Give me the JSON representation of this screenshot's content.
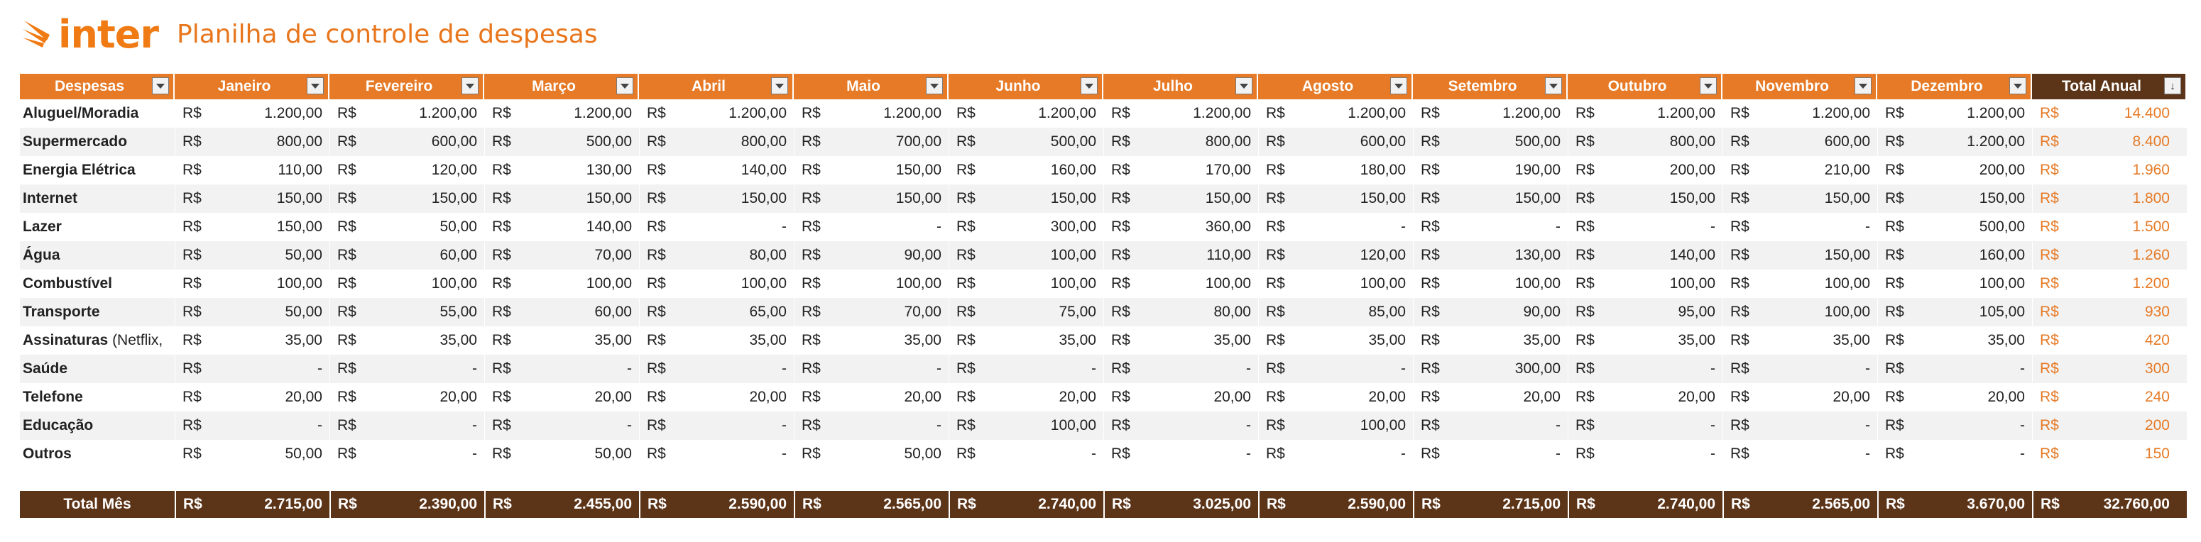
{
  "brand": {
    "logo_text": "inter",
    "accent": "#e67a26",
    "dark": "#5c3418"
  },
  "title": "Planilha de controle de despesas",
  "currency": "R$",
  "columns": {
    "expense": "Despesas",
    "months": [
      "Janeiro",
      "Fevereiro",
      "Março",
      "Abril",
      "Maio",
      "Junho",
      "Julho",
      "Agosto",
      "Setembro",
      "Outubro",
      "Novembro",
      "Dezembro"
    ],
    "total": "Total Anual"
  },
  "rows": [
    {
      "name": "Aluguel/Moradia",
      "values": [
        "1.200,00",
        "1.200,00",
        "1.200,00",
        "1.200,00",
        "1.200,00",
        "1.200,00",
        "1.200,00",
        "1.200,00",
        "1.200,00",
        "1.200,00",
        "1.200,00",
        "1.200,00"
      ],
      "total": "14.400"
    },
    {
      "name": "Supermercado",
      "values": [
        "800,00",
        "600,00",
        "500,00",
        "800,00",
        "700,00",
        "500,00",
        "800,00",
        "600,00",
        "500,00",
        "800,00",
        "600,00",
        "1.200,00"
      ],
      "total": "8.400"
    },
    {
      "name": "Energia Elétrica",
      "values": [
        "110,00",
        "120,00",
        "130,00",
        "140,00",
        "150,00",
        "160,00",
        "170,00",
        "180,00",
        "190,00",
        "200,00",
        "210,00",
        "200,00"
      ],
      "total": "1.960"
    },
    {
      "name": "Internet",
      "values": [
        "150,00",
        "150,00",
        "150,00",
        "150,00",
        "150,00",
        "150,00",
        "150,00",
        "150,00",
        "150,00",
        "150,00",
        "150,00",
        "150,00"
      ],
      "total": "1.800"
    },
    {
      "name": "Lazer",
      "values": [
        "150,00",
        "50,00",
        "140,00",
        "-",
        "-",
        "300,00",
        "360,00",
        "-",
        "-",
        "-",
        "-",
        "500,00"
      ],
      "total": "1.500"
    },
    {
      "name": "Água",
      "values": [
        "50,00",
        "60,00",
        "70,00",
        "80,00",
        "90,00",
        "100,00",
        "110,00",
        "120,00",
        "130,00",
        "140,00",
        "150,00",
        "160,00"
      ],
      "total": "1.260"
    },
    {
      "name": "Combustível",
      "values": [
        "100,00",
        "100,00",
        "100,00",
        "100,00",
        "100,00",
        "100,00",
        "100,00",
        "100,00",
        "100,00",
        "100,00",
        "100,00",
        "100,00"
      ],
      "total": "1.200"
    },
    {
      "name": "Transporte",
      "values": [
        "50,00",
        "55,00",
        "60,00",
        "65,00",
        "70,00",
        "75,00",
        "80,00",
        "85,00",
        "90,00",
        "95,00",
        "100,00",
        "105,00"
      ],
      "total": "930"
    },
    {
      "name": "Assinaturas",
      "note": "(Netflix,",
      "values": [
        "35,00",
        "35,00",
        "35,00",
        "35,00",
        "35,00",
        "35,00",
        "35,00",
        "35,00",
        "35,00",
        "35,00",
        "35,00",
        "35,00"
      ],
      "total": "420"
    },
    {
      "name": "Saúde",
      "values": [
        "-",
        "-",
        "-",
        "-",
        "-",
        "-",
        "-",
        "-",
        "300,00",
        "-",
        "-",
        "-"
      ],
      "total": "300"
    },
    {
      "name": "Telefone",
      "values": [
        "20,00",
        "20,00",
        "20,00",
        "20,00",
        "20,00",
        "20,00",
        "20,00",
        "20,00",
        "20,00",
        "20,00",
        "20,00",
        "20,00"
      ],
      "total": "240"
    },
    {
      "name": "Educação",
      "values": [
        "-",
        "-",
        "-",
        "-",
        "-",
        "100,00",
        "-",
        "100,00",
        "-",
        "-",
        "-",
        "-"
      ],
      "total": "200"
    },
    {
      "name": "Outros",
      "values": [
        "50,00",
        "-",
        "50,00",
        "-",
        "50,00",
        "-",
        "-",
        "-",
        "-",
        "-",
        "-",
        "-"
      ],
      "total": "150"
    }
  ],
  "footer": {
    "label": "Total Mês",
    "values": [
      "2.715,00",
      "2.390,00",
      "2.455,00",
      "2.590,00",
      "2.565,00",
      "2.740,00",
      "3.025,00",
      "2.590,00",
      "2.715,00",
      "2.740,00",
      "2.565,00",
      "3.670,00"
    ],
    "total": "32.760,00"
  }
}
